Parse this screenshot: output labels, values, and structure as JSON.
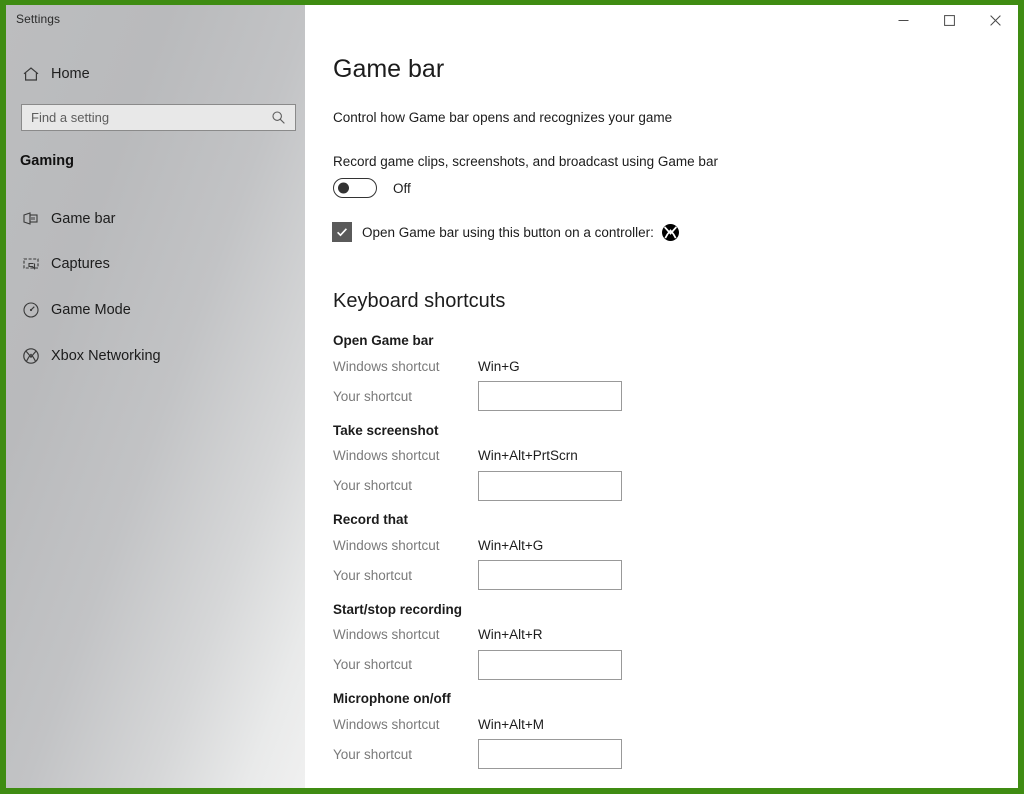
{
  "window": {
    "title": "Settings",
    "controls": {
      "minimize": "minimize-icon",
      "maximize": "maximize-icon",
      "close": "close-icon"
    },
    "accent_color": "#3f8c12"
  },
  "sidebar": {
    "home_label": "Home",
    "home_icon": "home-icon",
    "search": {
      "placeholder": "Find a setting",
      "value": "",
      "icon": "search-icon"
    },
    "section_heading": "Gaming",
    "items": [
      {
        "label": "Game bar",
        "icon": "game-bar-icon",
        "selected": true
      },
      {
        "label": "Captures",
        "icon": "captures-icon",
        "selected": false
      },
      {
        "label": "Game Mode",
        "icon": "game-mode-icon",
        "selected": false
      },
      {
        "label": "Xbox Networking",
        "icon": "xbox-icon",
        "selected": false
      }
    ]
  },
  "content": {
    "title": "Game bar",
    "subtitle": "Control how Game bar opens and recognizes your game",
    "toggle": {
      "caption": "Record game clips, screenshots, and broadcast using Game bar",
      "state_label": "Off",
      "checked": false
    },
    "controller_checkbox": {
      "label": "Open Game bar using this button on a controller:",
      "checked": true,
      "icon": "xbox-icon"
    },
    "shortcuts_heading": "Keyboard shortcuts",
    "row_labels": {
      "windows_shortcut": "Windows shortcut",
      "your_shortcut": "Your shortcut"
    },
    "shortcuts": [
      {
        "title": "Open Game bar",
        "windows_shortcut": "Win+G",
        "your_shortcut": ""
      },
      {
        "title": "Take screenshot",
        "windows_shortcut": "Win+Alt+PrtScrn",
        "your_shortcut": ""
      },
      {
        "title": "Record that",
        "windows_shortcut": "Win+Alt+G",
        "your_shortcut": ""
      },
      {
        "title": "Start/stop recording",
        "windows_shortcut": "Win+Alt+R",
        "your_shortcut": ""
      },
      {
        "title": "Microphone on/off",
        "windows_shortcut": "Win+Alt+M",
        "your_shortcut": ""
      }
    ]
  }
}
